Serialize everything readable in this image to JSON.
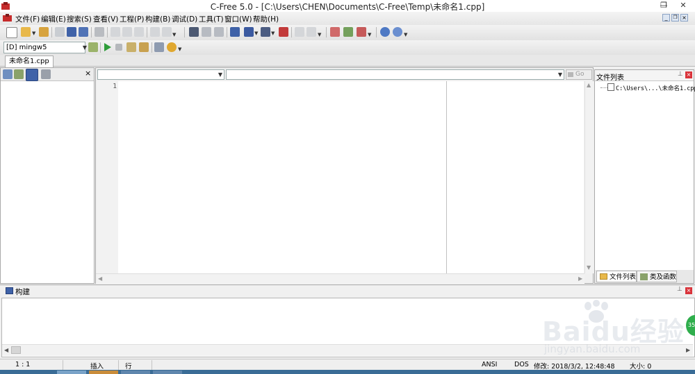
{
  "window": {
    "title": "C-Free 5.0 - [C:\\Users\\CHEN\\Documents\\C-Free\\Temp\\未命名1.cpp]",
    "restore_glyph": "❐",
    "close_glyph": "✕"
  },
  "menu": [
    "文件(F)",
    "编辑(E)",
    "搜索(S)",
    "查看(V)",
    "工程(P)",
    "构建(B)",
    "调试(D)",
    "工具(T)",
    "窗口(W)",
    "帮助(H)"
  ],
  "toolbar": {
    "compiler_select": "[D] mingw5",
    "icons": [
      "new-file-icon",
      "open-folder-icon",
      "open-project-icon",
      "close-file-icon",
      "save-icon",
      "save-all-icon",
      "print-icon",
      "cut-icon",
      "copy-icon",
      "paste-icon",
      "undo-icon",
      "redo-icon",
      "find-icon",
      "find-in-files-icon",
      "replace-icon",
      "goto-icon",
      "edit-icon",
      "bookmark-icon",
      "indent-icon",
      "nav-back-icon",
      "nav-forward-icon",
      "help-icon",
      "info-icon"
    ],
    "build_icons": [
      "compile-icon",
      "run-icon",
      "stop-icon",
      "build-icon",
      "rebuild-icon",
      "debug-icon",
      "breakpoint-icon"
    ]
  },
  "document_tab": "未命名1.cpp",
  "editor": {
    "line_numbers": [
      "1"
    ],
    "go_button": "Go"
  },
  "right_panel": {
    "title": "文件列表",
    "file_node": "C:\\Users\\...\\未命名1.cpp",
    "tabs": [
      "文件列表",
      "类及函数"
    ]
  },
  "build_panel": {
    "title": "构建"
  },
  "statusbar": {
    "position": "1 :  1",
    "mode": "插入",
    "unit": "行",
    "encoding": "ANSI",
    "line_ending": "DOS",
    "modified": "修改: 2018/3/2, 12:48:48",
    "size": "大小: 0"
  },
  "watermark": {
    "brand": "Baidu经验",
    "url": "jingyan.baidu.com"
  },
  "badge": "35"
}
